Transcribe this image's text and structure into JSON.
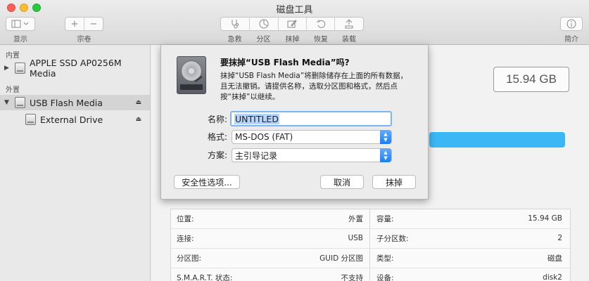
{
  "window": {
    "title": "磁盘工具"
  },
  "toolbar": {
    "display_label": "显示",
    "volume_label": "宗卷",
    "first_aid_label": "急救",
    "partition_label": "分区",
    "erase_label": "抹掉",
    "restore_label": "恢复",
    "mount_label": "装载",
    "info_label": "简介"
  },
  "sidebar": {
    "internal_header": "内置",
    "external_header": "外置",
    "items": [
      {
        "label": "APPLE SSD AP0256M Media"
      },
      {
        "label": "USB Flash Media"
      },
      {
        "label": "External Drive"
      }
    ]
  },
  "main": {
    "capacity": "15.94 GB",
    "info": {
      "left": [
        {
          "key": "位置:",
          "value": "外置"
        },
        {
          "key": "连接:",
          "value": "USB"
        },
        {
          "key": "分区图:",
          "value": "GUID 分区图"
        },
        {
          "key": "S.M.A.R.T. 状态:",
          "value": "不支持"
        }
      ],
      "right": [
        {
          "key": "容量:",
          "value": "15.94 GB"
        },
        {
          "key": "子分区数:",
          "value": "2"
        },
        {
          "key": "类型:",
          "value": "磁盘"
        },
        {
          "key": "设备:",
          "value": "disk2"
        }
      ]
    }
  },
  "sheet": {
    "title": "要抹掉“USB Flash Media”吗?",
    "message": "抹掉“USB Flash Media”将删除储存在上面的所有数据，且无法撤销。请提供名称，选取分区图和格式，然后点按“抹掉”以继续。",
    "name_label": "名称:",
    "name_value": "UNTITLED",
    "format_label": "格式:",
    "format_value": "MS-DOS (FAT)",
    "scheme_label": "方案:",
    "scheme_value": "主引导记录",
    "security_button": "安全性选项...",
    "cancel_button": "取消",
    "erase_button": "抹掉"
  },
  "colors": {
    "accent": "#3bb7f5",
    "focus_ring": "#7db4f2",
    "popup_arrow": "#1a7ef6"
  }
}
